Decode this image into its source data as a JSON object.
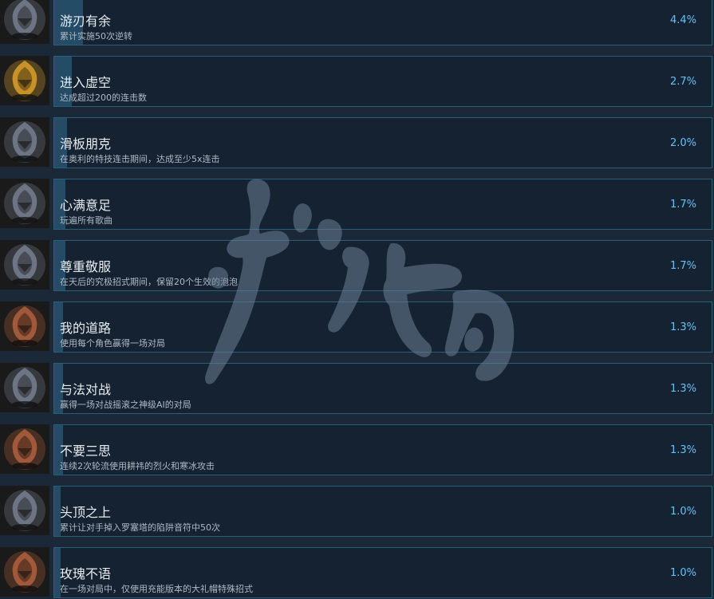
{
  "achievements": [
    {
      "title": "游刃有余",
      "desc": "累计实施50次逆转",
      "percent": "4.4%",
      "rate": 4.4,
      "icon": "silver-trophy-icon",
      "tint": "#6d7585"
    },
    {
      "title": "进入虚空",
      "desc": "达成超过200的连击数",
      "percent": "2.7%",
      "rate": 2.7,
      "icon": "gold-trophy-icon",
      "tint": "#c8922a"
    },
    {
      "title": "滑板朋克",
      "desc": "在奥利的特技连击期间，达成至少5x连击",
      "percent": "2.0%",
      "rate": 2.0,
      "icon": "silver-trophy-icon",
      "tint": "#6d7585"
    },
    {
      "title": "心满意足",
      "desc": "玩遍所有歌曲",
      "percent": "1.7%",
      "rate": 1.7,
      "icon": "silver-trophy-icon",
      "tint": "#6d7585"
    },
    {
      "title": "尊重敬服",
      "desc": "在天后的究极招式期间，保留20个生效的泡泡",
      "percent": "1.7%",
      "rate": 1.7,
      "icon": "silver-trophy-icon",
      "tint": "#6d7585"
    },
    {
      "title": "我的道路",
      "desc": "使用每个角色赢得一场对局",
      "percent": "1.3%",
      "rate": 1.3,
      "icon": "bronze-trophy-icon",
      "tint": "#a0593a"
    },
    {
      "title": "与法对战",
      "desc": "赢得一场对战摇滚之神级AI的对局",
      "percent": "1.3%",
      "rate": 1.3,
      "icon": "silver-trophy-icon",
      "tint": "#6d7585"
    },
    {
      "title": "不要三思",
      "desc": "连续2次轮流使用耕祎的烈火和寒冰攻击",
      "percent": "1.3%",
      "rate": 1.3,
      "icon": "bronze-trophy-icon",
      "tint": "#a0593a"
    },
    {
      "title": "头顶之上",
      "desc": "累计让对手掉入罗塞塔的陷阱音符中50次",
      "percent": "1.0%",
      "rate": 1.0,
      "icon": "silver-trophy-icon",
      "tint": "#6d7585"
    },
    {
      "title": "玫瑰不语",
      "desc": "在一场对局中，仅使用充能版本的大礼帽特殊招式",
      "percent": "1.0%",
      "rate": 1.0,
      "icon": "bronze-trophy-icon",
      "tint": "#a0593a"
    }
  ],
  "colors": {
    "background": "#1b2838",
    "bar_border": "#2a5f79",
    "bar_fill": "#254c66",
    "percent_text": "#66c0f4"
  }
}
